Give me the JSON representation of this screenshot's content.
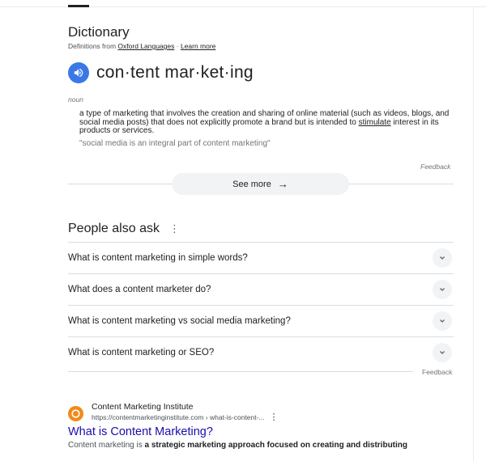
{
  "dictionary": {
    "title": "Dictionary",
    "source_prefix": "Definitions from ",
    "source_link": "Oxford Languages",
    "separator": " · ",
    "learn_more": "Learn more",
    "headword": "con·tent mar·ket·ing",
    "part_of_speech": "noun",
    "definition_before": "a type of marketing that involves the creation and sharing of online material (such as videos, blogs, and social media posts) that does not explicitly promote a brand but is intended to ",
    "definition_link": "stimulate",
    "definition_after": " interest in its products or services.",
    "example": "\"social media is an integral part of content marketing\"",
    "feedback": "Feedback",
    "see_more": "See more"
  },
  "people_also_ask": {
    "title": "People also ask",
    "questions": [
      "What is content marketing in simple words?",
      "What does a content marketer do?",
      "What is content marketing vs social media marketing?",
      "What is content marketing or SEO?"
    ],
    "feedback": "Feedback"
  },
  "result": {
    "site_name": "Content Marketing Institute",
    "url": "https://contentmarketinginstitute.com › what-is-content-...",
    "title": "What is Content Marketing?",
    "snippet_prefix": "Content marketing is ",
    "snippet_bold": "a strategic marketing approach focused on creating and distributing"
  },
  "colors": {
    "speaker_button": "#3b78e7",
    "link_title": "#1a0dab",
    "favicon": "#f08a1c"
  }
}
